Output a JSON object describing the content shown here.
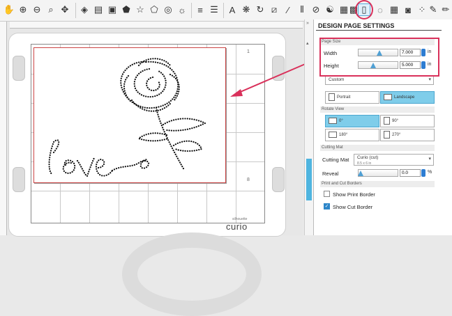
{
  "toolbar": {
    "icons": [
      "pan-icon",
      "zoom-in-icon",
      "zoom-out-icon",
      "zoom-selection-icon",
      "fit-to-page-icon",
      "fill-color-icon",
      "line-style-icon",
      "shadow-icon",
      "pentagon-icon",
      "star-icon",
      "cloud-shape-icon",
      "circle-shape-icon",
      "line-color-icon",
      "line-width-icon",
      "text-icon",
      "replicate-icon",
      "rotate-icon",
      "edit-points-icon",
      "knife-icon",
      "align-icon",
      "offset-icon",
      "trace-icon",
      "send-to-icon",
      "page-setup-icon",
      "emboss-icon",
      "grid-icon",
      "registration-icon",
      "store-icon",
      "cut-settings-icon"
    ],
    "text_label": "A"
  },
  "design_panel": {
    "title": "DESIGN PAGE SETTINGS",
    "page_size": {
      "section": "Page Size",
      "width_label": "Width",
      "width_value": "7.000",
      "height_label": "Height",
      "height_value": "5.000",
      "unit": "in",
      "width_slider_level": 0.55,
      "height_slider_level": 0.35
    },
    "size_preset": "Custom",
    "orientation": {
      "portrait": "Portrait",
      "landscape": "Landscape",
      "selected": "Landscape"
    },
    "rotate_view": {
      "section": "Rotate View",
      "options": [
        "0°",
        "90°",
        "180°",
        "270°"
      ],
      "selected": "0°"
    },
    "cutting_mat": {
      "section": "Cutting Mat",
      "label": "Cutting Mat",
      "value": "Curio (cut)",
      "sub": "8.5 x 6 in",
      "reveal_label": "Reveal",
      "reveal_value": "0.0",
      "reveal_unit": "%"
    },
    "print_cut": {
      "section": "Print and Cut Borders",
      "show_print_border": "Show Print Border",
      "show_print_border_checked": false,
      "show_cut_border": "Show Cut Border",
      "show_cut_border_checked": true
    }
  },
  "canvas": {
    "brand": "curio",
    "brand_small": "silhouette",
    "ruler_numbers": [
      "1",
      "8"
    ],
    "artwork_word": "love"
  },
  "colors": {
    "accent": "#d9305a",
    "selected": "#7fcdea",
    "spin": "#2d7dd2"
  }
}
